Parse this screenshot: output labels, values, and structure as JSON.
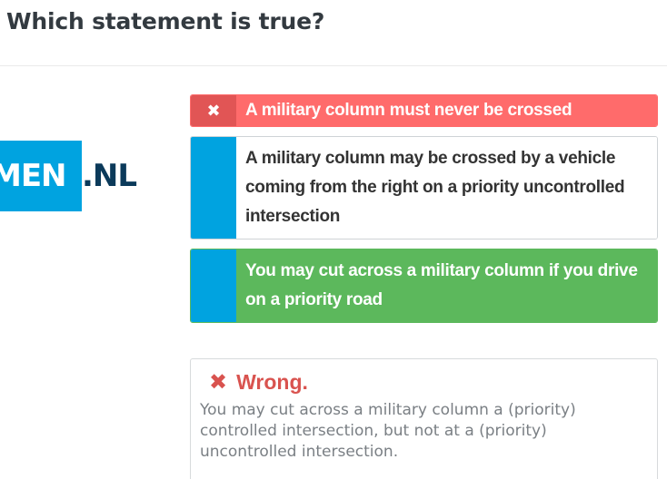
{
  "question": {
    "title": "Which statement is true?"
  },
  "logo": {
    "left_text": "MEN",
    "right_text": ".NL"
  },
  "answers": [
    {
      "state": "wrong",
      "marker_icon": "x-icon",
      "marker_glyph": "✖",
      "text": "A military column must never be crossed"
    },
    {
      "state": "neutral",
      "marker_icon": "",
      "marker_glyph": "",
      "text": "A military column may be crossed by a vehicle coming from the right on a priority uncontrolled intersection"
    },
    {
      "state": "correct",
      "marker_icon": "",
      "marker_glyph": "",
      "text": "You may cut across a military column if you drive on a priority road"
    }
  ],
  "feedback": {
    "icon": "x-icon",
    "icon_glyph": "✖",
    "title": "Wrong.",
    "body": "You may cut across a military column a (priority) controlled intersection, but not at a (priority) uncontrolled intersection."
  },
  "colors": {
    "wrong_bg": "#ff6b6b",
    "wrong_marker": "#e15555",
    "correct_bg": "#5cb85c",
    "marker_blue": "#00a3e0",
    "feedback_red": "#d9534f",
    "logo_dark": "#0b3a5a"
  }
}
